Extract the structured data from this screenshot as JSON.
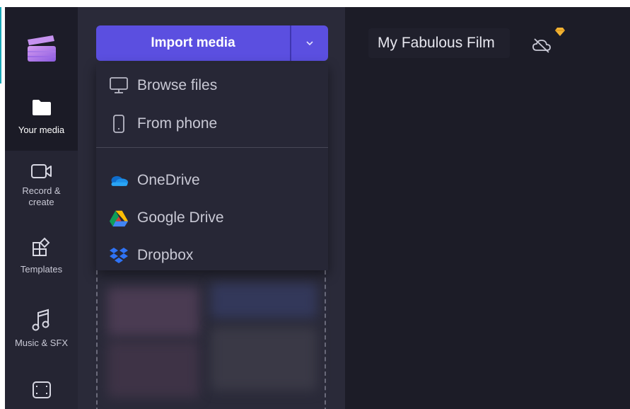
{
  "sidebar": {
    "items": [
      {
        "label": "Your media",
        "icon": "folder-icon",
        "active": true
      },
      {
        "label": "Record &\ncreate",
        "icon": "camera-icon"
      },
      {
        "label": "Templates",
        "icon": "templates-icon"
      },
      {
        "label": "Music & SFX",
        "icon": "music-note-icon"
      },
      {
        "label": "",
        "icon": "film-icon"
      }
    ]
  },
  "import": {
    "label": "Import media"
  },
  "dropdown": {
    "items": [
      {
        "label": "Browse files",
        "icon": "monitor-icon"
      },
      {
        "label": "From phone",
        "icon": "phone-icon"
      },
      {
        "label": "OneDrive",
        "icon": "onedrive-icon"
      },
      {
        "label": "Google Drive",
        "icon": "google-drive-icon"
      },
      {
        "label": "Dropbox",
        "icon": "dropbox-icon"
      }
    ]
  },
  "header": {
    "project_title": "My Fabulous Film"
  },
  "colors": {
    "accent": "#5b4fe0",
    "background": "#1c1c27",
    "rail": "#252533",
    "panel": "#2a2a39",
    "premium": "#f2b233"
  }
}
